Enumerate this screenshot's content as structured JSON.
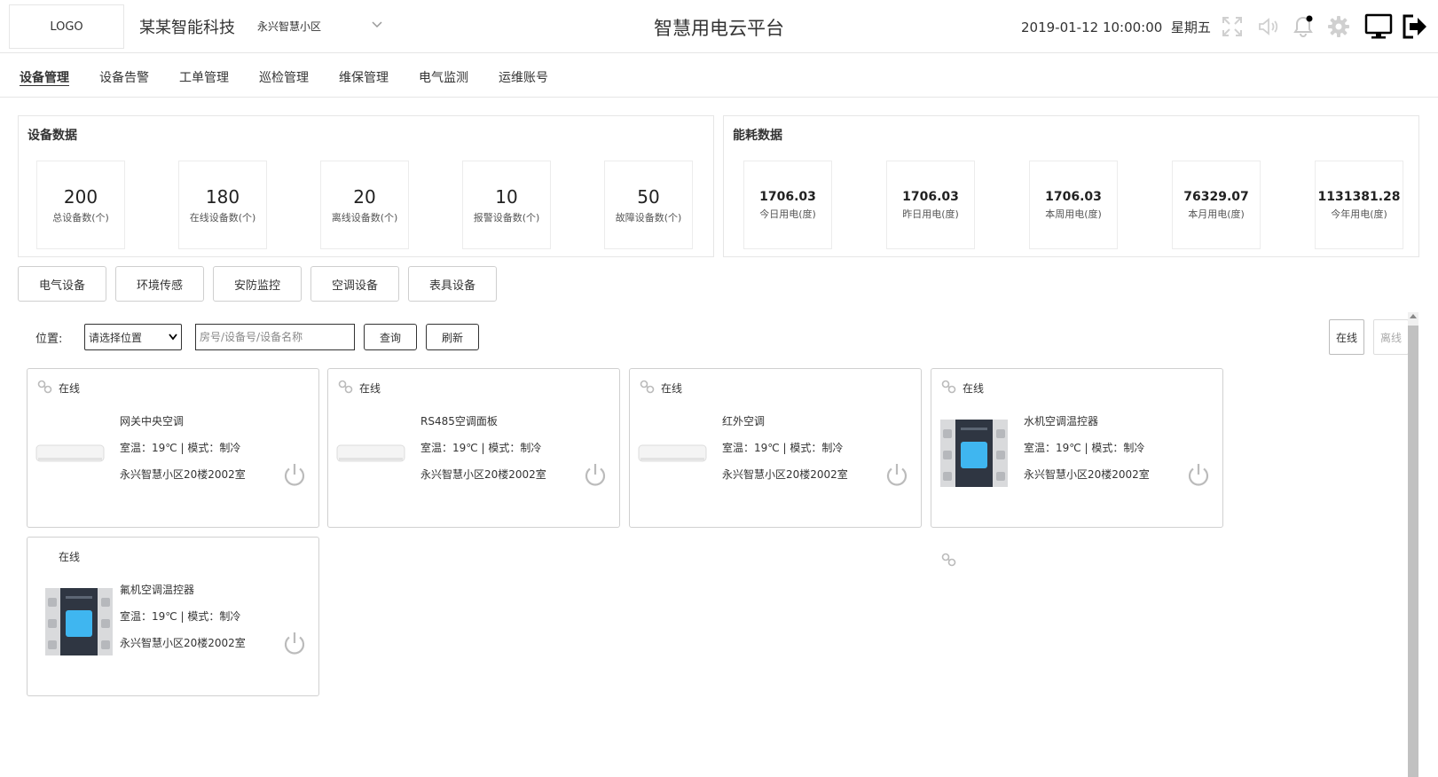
{
  "header": {
    "logo": "LOGO",
    "company": "某某智能科技",
    "community": "永兴智慧小区",
    "title": "智慧用电云平台",
    "datetime": "2019-01-12 10:00:00",
    "weekday": "星期五",
    "icons": [
      "fullscreen-icon",
      "volume-icon",
      "bell-icon",
      "gear-icon",
      "monitor-icon",
      "logout-icon"
    ]
  },
  "nav": {
    "items": [
      {
        "label": "设备管理",
        "active": true
      },
      {
        "label": "设备告警"
      },
      {
        "label": "工单管理"
      },
      {
        "label": "巡检管理"
      },
      {
        "label": "维保管理"
      },
      {
        "label": "电气监测"
      },
      {
        "label": "运维账号"
      }
    ]
  },
  "device_panel": {
    "title": "设备数据",
    "stats": [
      {
        "value": "200",
        "label": "总设备数(个)"
      },
      {
        "value": "180",
        "label": "在线设备数(个)"
      },
      {
        "value": "20",
        "label": "离线设备数(个)"
      },
      {
        "value": "10",
        "label": "报警设备数(个)"
      },
      {
        "value": "50",
        "label": "故障设备数(个)"
      }
    ]
  },
  "energy_panel": {
    "title": "能耗数据",
    "stats": [
      {
        "value": "1706.03",
        "label": "今日用电(度)"
      },
      {
        "value": "1706.03",
        "label": "昨日用电(度)"
      },
      {
        "value": "1706.03",
        "label": "本周用电(度)"
      },
      {
        "value": "76329.07",
        "label": "本月用电(度)"
      },
      {
        "value": "1131381.28",
        "label": "今年用电(度)"
      }
    ]
  },
  "categories": [
    "电气设备",
    "环境传感",
    "安防监控",
    "空调设备",
    "表具设备"
  ],
  "filter": {
    "location_label": "位置:",
    "location_select": "请选择位置",
    "search_placeholder": "房号/设备号/设备名称",
    "query": "查询",
    "refresh": "刷新"
  },
  "status_tabs": [
    "在线",
    "离线"
  ],
  "cards": [
    {
      "status": "在线",
      "name": "网关中央空调",
      "meta": "室温：19℃ | 模式：制冷",
      "location": "永兴智慧小区20楼2002室",
      "image": "ac-unit-image"
    },
    {
      "status": "在线",
      "name": "RS485空调面板",
      "meta": "室温：19℃ | 模式：制冷",
      "location": "永兴智慧小区20楼2002室",
      "image": "ac-unit-image"
    },
    {
      "status": "在线",
      "name": "红外空调",
      "meta": "室温：19℃ | 模式：制冷",
      "location": "永兴智慧小区20楼2002室",
      "image": "ac-unit-image"
    },
    {
      "status": "在线",
      "name": "水机空调温控器",
      "meta": "室温：19℃ | 模式：制冷",
      "location": "永兴智慧小区20楼2002室",
      "image": "thermostat-image"
    },
    {
      "status": "在线",
      "name": "氟机空调温控器",
      "meta": "室温：19℃ | 模式：制冷",
      "location": "永兴智慧小区20楼2002室",
      "image": "thermostat-image"
    }
  ],
  "colors": {
    "border": "#d0d0d0",
    "text": "#333333",
    "thumb": "#c1c1c1"
  }
}
